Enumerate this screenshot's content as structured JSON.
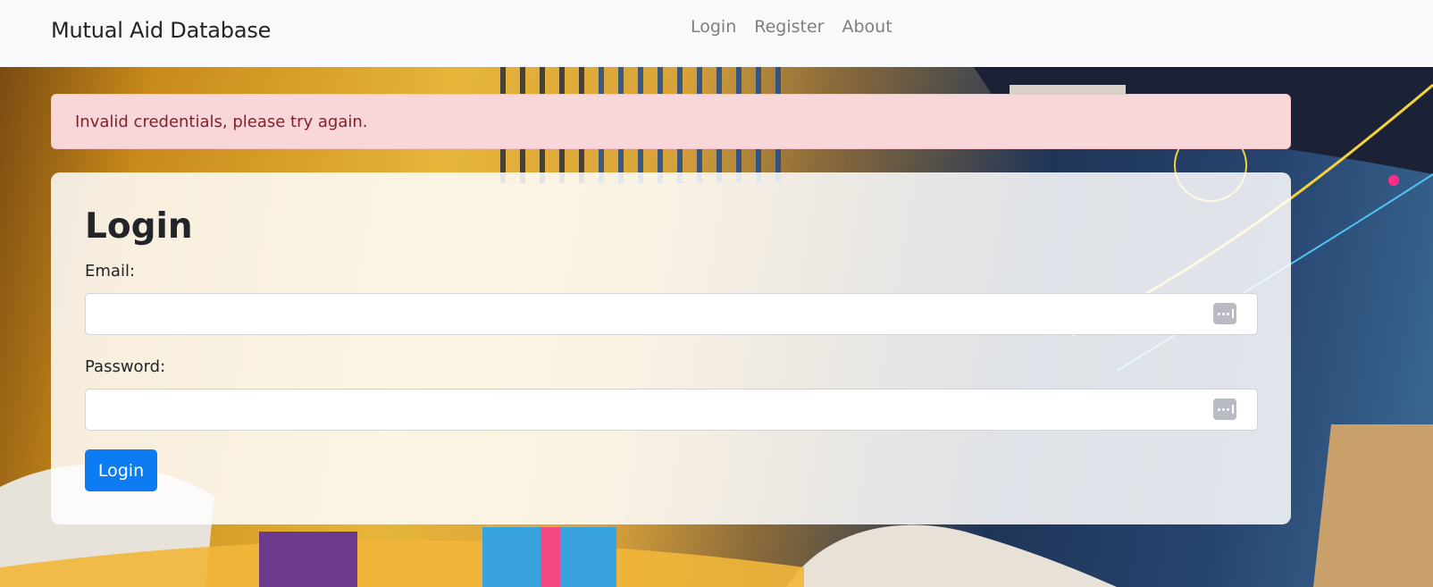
{
  "navbar": {
    "brand": "Mutual Aid Database",
    "links": [
      "Login",
      "Register",
      "About"
    ]
  },
  "alert": {
    "message": "Invalid credentials, please try again.",
    "bg_color": "#f8d7da",
    "text_color": "#842029"
  },
  "login_form": {
    "title": "Login",
    "email_label": "Email:",
    "email_value": "",
    "password_label": "Password:",
    "password_value": "",
    "field_icon": "password-manager-icon",
    "submit_label": "Login",
    "submit_color": "#0d7cf2"
  }
}
